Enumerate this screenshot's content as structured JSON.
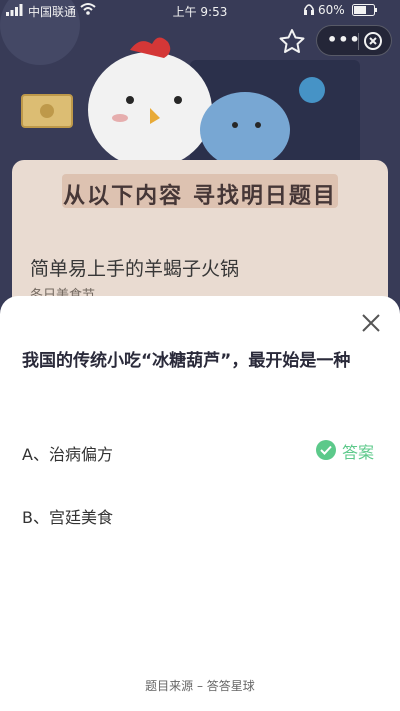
{
  "status_bar": {
    "carrier": "中国联通",
    "time": "上午 9:53",
    "battery": "60%"
  },
  "background": {
    "banner_title": "从以下内容 寻找明日题目",
    "recipe_title": "简单易上手的羊蝎子火锅",
    "recipe_sub": "冬日美食节"
  },
  "sheet": {
    "question": "我国的传统小吃“冰糖葫芦”，最开始是一种",
    "options": [
      {
        "label": "A、治病偏方"
      },
      {
        "label": "B、宫廷美食"
      }
    ],
    "answer_label": "答案",
    "source": "题目来源 – 答答星球"
  },
  "colors": {
    "accent_green": "#5cc98a",
    "bg_dark": "#3b3f5c"
  }
}
